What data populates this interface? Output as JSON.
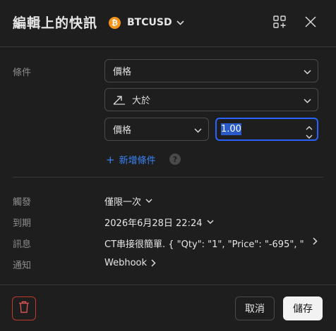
{
  "header": {
    "title": "編輯上的快訊",
    "symbol": "BTCUSD",
    "symbol_icon": "bitcoin-icon",
    "add_icon": "add-to-watchlist-icon",
    "close_icon": "close-icon"
  },
  "conditions": {
    "label": "條件",
    "source": "價格",
    "operator": "大於",
    "operator_icon": "trend-up-icon",
    "target_type": "價格",
    "value": "1.00",
    "add_condition": "新增條件",
    "help_icon": "?"
  },
  "settings": {
    "trigger": {
      "label": "觸發",
      "value": "僅限一次"
    },
    "expiry": {
      "label": "到期",
      "value": "2026年6月28日 22:24"
    },
    "message": {
      "label": "訊息",
      "value": "CT串接很簡單. { \"Qty\": \"1\", \"Price\": \"-695\", \"..."
    },
    "notify": {
      "label": "通知",
      "value": "Webhook"
    }
  },
  "footer": {
    "delete_icon": "trash-icon",
    "cancel": "取消",
    "save": "儲存"
  },
  "colors": {
    "background": "#1e1e1e",
    "accent_blue": "#2962ff",
    "link_blue": "#3b82f6",
    "danger_red": "#c0392b",
    "bitcoin_orange": "#f7931a"
  }
}
